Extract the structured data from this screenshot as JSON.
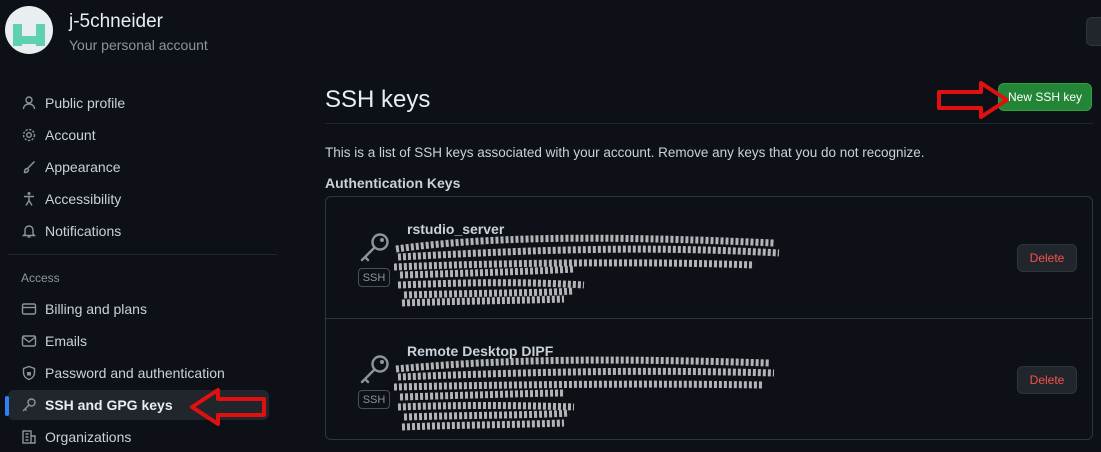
{
  "account": {
    "name": "j-5chneider",
    "subtitle": "Your personal account"
  },
  "sidebar": {
    "items": [
      {
        "label": "Public profile",
        "icon": "person-icon"
      },
      {
        "label": "Account",
        "icon": "gear-icon"
      },
      {
        "label": "Appearance",
        "icon": "paintbrush-icon"
      },
      {
        "label": "Accessibility",
        "icon": "accessibility-icon"
      },
      {
        "label": "Notifications",
        "icon": "bell-icon"
      }
    ],
    "access_label": "Access",
    "access_items": [
      {
        "label": "Billing and plans",
        "icon": "credit-card-icon"
      },
      {
        "label": "Emails",
        "icon": "mail-icon"
      },
      {
        "label": "Password and authentication",
        "icon": "shield-lock-icon"
      },
      {
        "label": "SSH and GPG keys",
        "icon": "key-icon",
        "active": true
      },
      {
        "label": "Organizations",
        "icon": "organization-icon"
      }
    ]
  },
  "main": {
    "title": "SSH keys",
    "new_key_label": "New SSH key",
    "description": "This is a list of SSH keys associated with your account. Remove any keys that you do not recognize.",
    "section_title": "Authentication Keys",
    "keys": [
      {
        "title": "rstudio_server",
        "badge": "SSH",
        "delete_label": "Delete"
      },
      {
        "title": "Remote Desktop DIPF",
        "badge": "SSH",
        "delete_label": "Delete"
      }
    ]
  },
  "colors": {
    "accent": "#2f81f7",
    "primary_button": "#238636",
    "danger": "#f85149",
    "annotation_arrow": "#e01010"
  }
}
